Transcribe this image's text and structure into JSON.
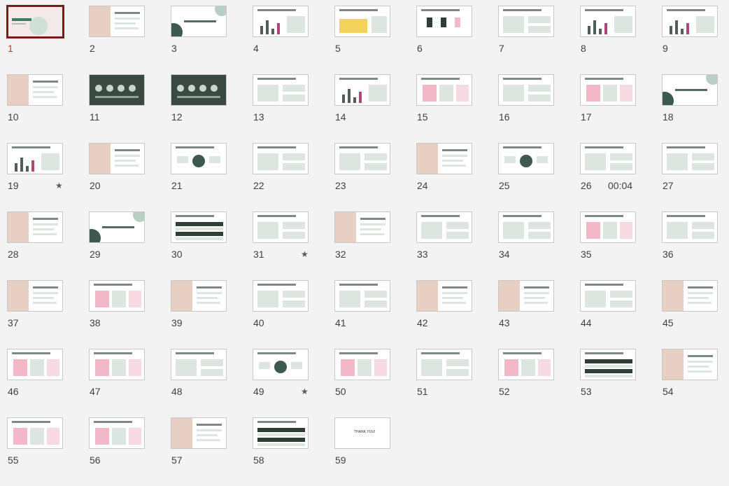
{
  "slides": [
    {
      "n": "1",
      "selected": true,
      "variant": "pinkbg"
    },
    {
      "n": "2",
      "variant": "photo"
    },
    {
      "n": "3",
      "variant": "section"
    },
    {
      "n": "4",
      "variant": "chart"
    },
    {
      "n": "5",
      "variant": "yellowchart"
    },
    {
      "n": "6",
      "variant": "icons"
    },
    {
      "n": "7",
      "variant": "text"
    },
    {
      "n": "8",
      "variant": "chart"
    },
    {
      "n": "9",
      "variant": "chart"
    },
    {
      "n": "10",
      "variant": "photo"
    },
    {
      "n": "11",
      "variant": "darkbg"
    },
    {
      "n": "12",
      "variant": "darkbg"
    },
    {
      "n": "13",
      "variant": "text"
    },
    {
      "n": "14",
      "variant": "chart"
    },
    {
      "n": "15",
      "variant": "pink"
    },
    {
      "n": "16",
      "variant": "text"
    },
    {
      "n": "17",
      "variant": "pink"
    },
    {
      "n": "18",
      "variant": "section"
    },
    {
      "n": "19",
      "variant": "chart",
      "star": true
    },
    {
      "n": "20",
      "variant": "photo"
    },
    {
      "n": "21",
      "variant": "diagram"
    },
    {
      "n": "22",
      "variant": "text"
    },
    {
      "n": "23",
      "variant": "text"
    },
    {
      "n": "24",
      "variant": "photo"
    },
    {
      "n": "25",
      "variant": "diagram"
    },
    {
      "n": "26",
      "variant": "text",
      "timing": "00:04"
    },
    {
      "n": "27",
      "variant": "text"
    },
    {
      "n": "28",
      "variant": "photo"
    },
    {
      "n": "29",
      "variant": "section"
    },
    {
      "n": "30",
      "variant": "dark"
    },
    {
      "n": "31",
      "variant": "text",
      "star": true
    },
    {
      "n": "32",
      "variant": "photo"
    },
    {
      "n": "33",
      "variant": "text"
    },
    {
      "n": "34",
      "variant": "text"
    },
    {
      "n": "35",
      "variant": "pink"
    },
    {
      "n": "36",
      "variant": "text"
    },
    {
      "n": "37",
      "variant": "photo"
    },
    {
      "n": "38",
      "variant": "pink"
    },
    {
      "n": "39",
      "variant": "photo"
    },
    {
      "n": "40",
      "variant": "text"
    },
    {
      "n": "41",
      "variant": "text"
    },
    {
      "n": "42",
      "variant": "photo"
    },
    {
      "n": "43",
      "variant": "photo"
    },
    {
      "n": "44",
      "variant": "text"
    },
    {
      "n": "45",
      "variant": "photo"
    },
    {
      "n": "46",
      "variant": "pink"
    },
    {
      "n": "47",
      "variant": "pink"
    },
    {
      "n": "48",
      "variant": "text"
    },
    {
      "n": "49",
      "variant": "diagram",
      "star": true
    },
    {
      "n": "50",
      "variant": "pink"
    },
    {
      "n": "51",
      "variant": "text"
    },
    {
      "n": "52",
      "variant": "pink"
    },
    {
      "n": "53",
      "variant": "dark"
    },
    {
      "n": "54",
      "variant": "photo"
    },
    {
      "n": "55",
      "variant": "pink"
    },
    {
      "n": "56",
      "variant": "pink"
    },
    {
      "n": "57",
      "variant": "photo"
    },
    {
      "n": "58",
      "variant": "dark"
    },
    {
      "n": "59",
      "variant": "end",
      "end_text": "THANK YOU!"
    }
  ],
  "icons": {
    "star": "★"
  },
  "colors": {
    "selection_border": "#7a1c1c",
    "selected_number": "#c0392b",
    "background": "#f3f3f3"
  }
}
